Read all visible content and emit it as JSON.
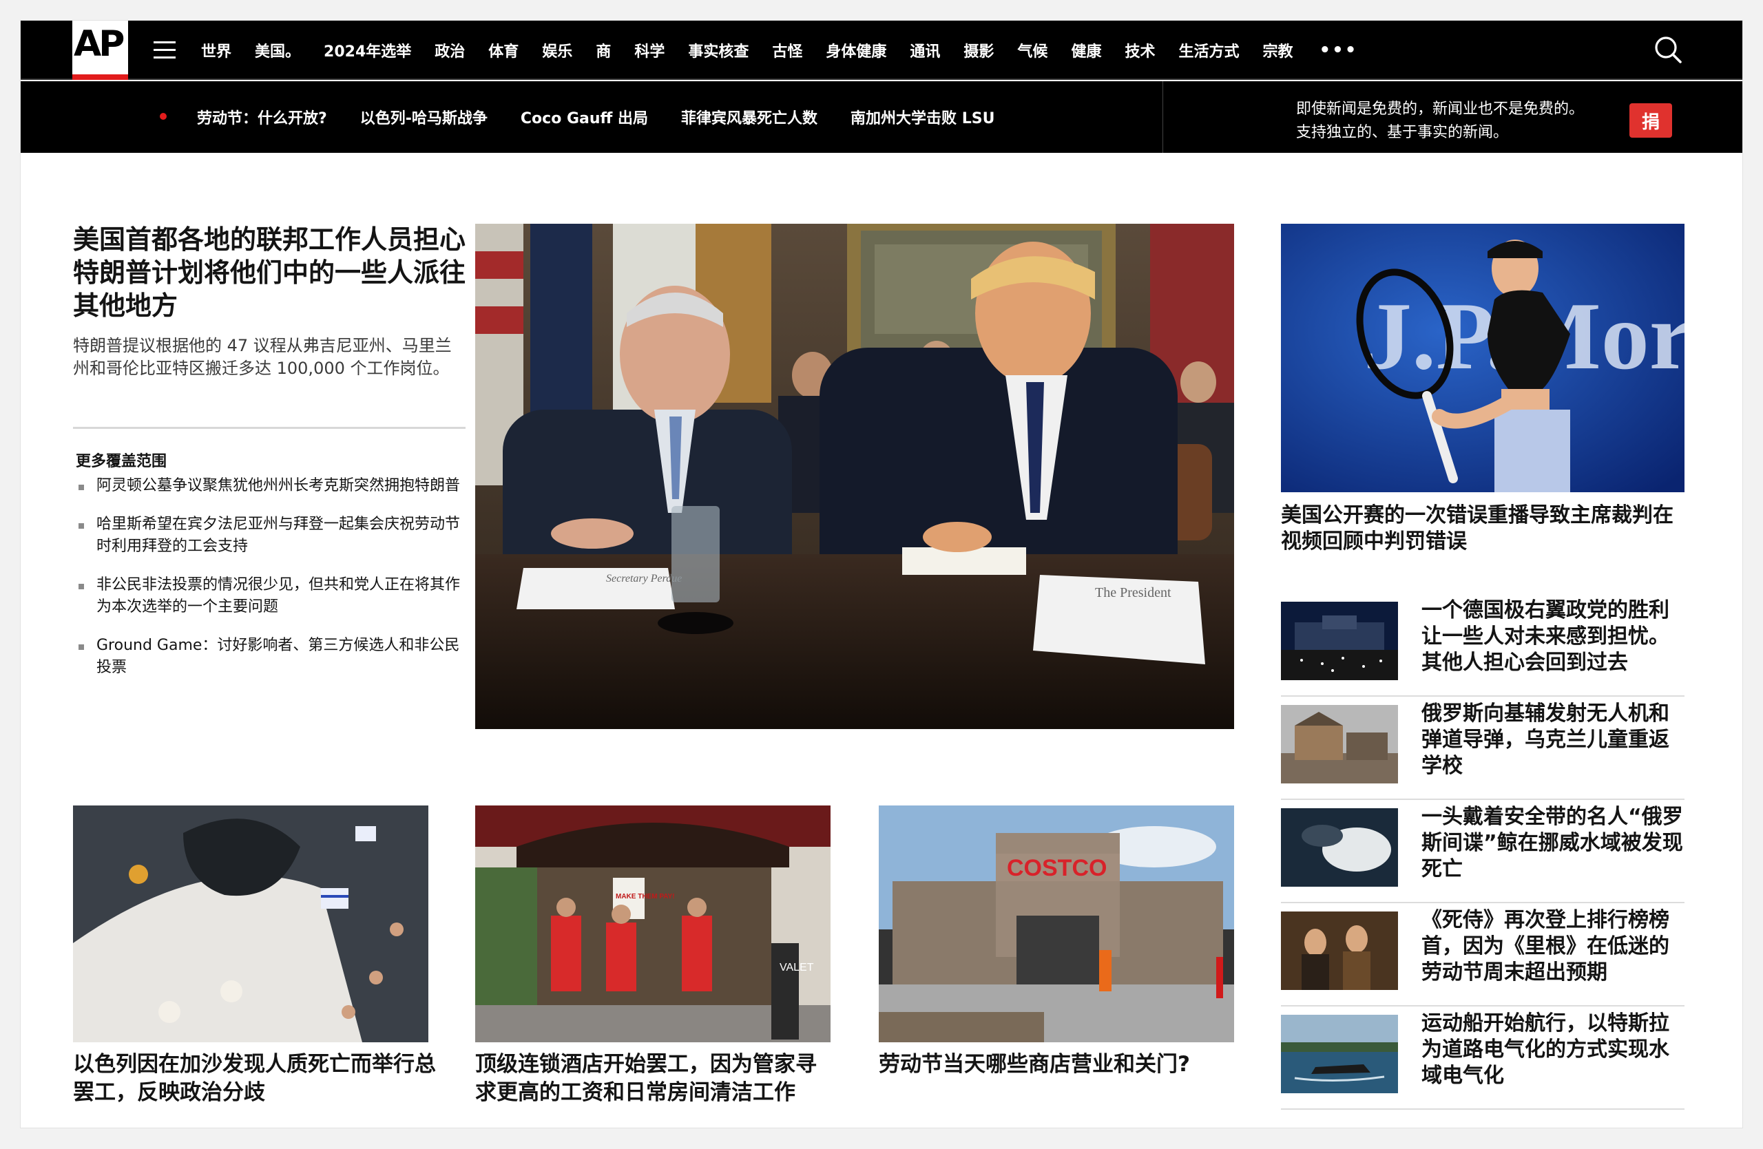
{
  "nav": {
    "logo": "AP",
    "items": [
      "世界",
      "美国。",
      "2024年选举",
      "政治",
      "体育",
      "娱乐",
      "商",
      "科学",
      "事实核查",
      "古怪",
      "身体健康",
      "通讯",
      "摄影",
      "气候",
      "健康",
      "技术",
      "生活方式",
      "宗教"
    ],
    "more": "•••"
  },
  "trending": {
    "items": [
      "劳动节：什么开放?",
      "以色列-哈马斯战争",
      "Coco Gauff 出局",
      "菲律宾风暴死亡人数",
      "南加州大学击败 LSU"
    ],
    "donate_line1": "即使新闻是免费的，新闻业也不是免费的。",
    "donate_line2": "支持独立的、基于事实的新闻。",
    "donate_button": "捐"
  },
  "lead": {
    "headline": "美国首都各地的联邦工作人员担心特朗普计划将他们中的一些人派往其他地方",
    "summary": "特朗普提议根据他的 47 议程从弗吉尼亚州、马里兰州和哥伦比亚特区搬迁多达 100,000 个工作岗位。",
    "more_title": "更多覆盖范围",
    "more_items": [
      "阿灵顿公墓争议聚焦犹他州州长考克斯突然拥抱特朗普",
      "哈里斯希望在宾夕法尼亚州与拜登一起集会庆祝劳动节时利用拜登的工会支持",
      "非公民非法投票的情况很少见，但共和党人正在将其作为本次选举的一个主要问题",
      "Ground Game：讨好影响者、第三方候选人和非公民投票"
    ],
    "photo_signs": {
      "left": "Secretary Perdue",
      "right": "The President"
    }
  },
  "feature": {
    "headline": "美国公开赛的一次错误重播导致主席裁判在视频回顾中判罚错误",
    "photo_backdrop": "J.P.Mor"
  },
  "rail": [
    "一个德国极右翼政党的胜利让一些人对未来感到担忧。其他人担心会回到过去",
    "俄罗斯向基辅发射无人机和弹道导弹，乌克兰儿童重返学校",
    "一头戴着安全带的名人“俄罗斯间谍”鲸在挪威水域被发现死亡",
    "《死侍》再次登上排行榜榜首，因为《里根》在低迷的劳动节周末超出预期",
    "运动船开始航行，以特斯拉为道路电气化的方式实现水域电气化"
  ],
  "bottom": [
    {
      "headline": "以色列因在加沙发现人质死亡而举行总罢工，反映政治分歧"
    },
    {
      "headline": "顶级连锁酒店开始罢工，因为管家寻求更高的工资和日常房间清洁工作",
      "sign": "MAKE THEM PAY!",
      "valet": "VALET"
    },
    {
      "headline": "劳动节当天哪些商店营业和关门?",
      "store_sign": "COSTCO"
    }
  ],
  "colors": {
    "accent_red": "#e21c1c",
    "donate_red": "#e0322e",
    "nav_bg": "#000000"
  }
}
